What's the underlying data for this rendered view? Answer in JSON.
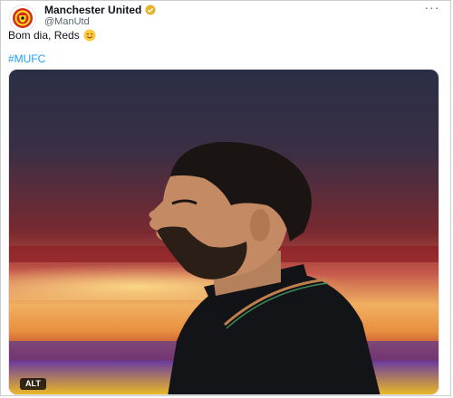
{
  "account": {
    "display_name": "Manchester United",
    "handle": "@ManUtd",
    "avatar_icon": "manutd-crest-icon",
    "verified_icon": "verified-badge-icon",
    "verified_color": "#e8b32a"
  },
  "tweet": {
    "text": "Bom dia, Reds",
    "emoji_icon": "smiling-face-emoji-icon",
    "hashtag": "#MUFC",
    "link_color": "#1d9bf0"
  },
  "media": {
    "alt_label": "ALT"
  },
  "menu": {
    "more_icon": "more-horizontal-icon",
    "more_label": "···"
  }
}
